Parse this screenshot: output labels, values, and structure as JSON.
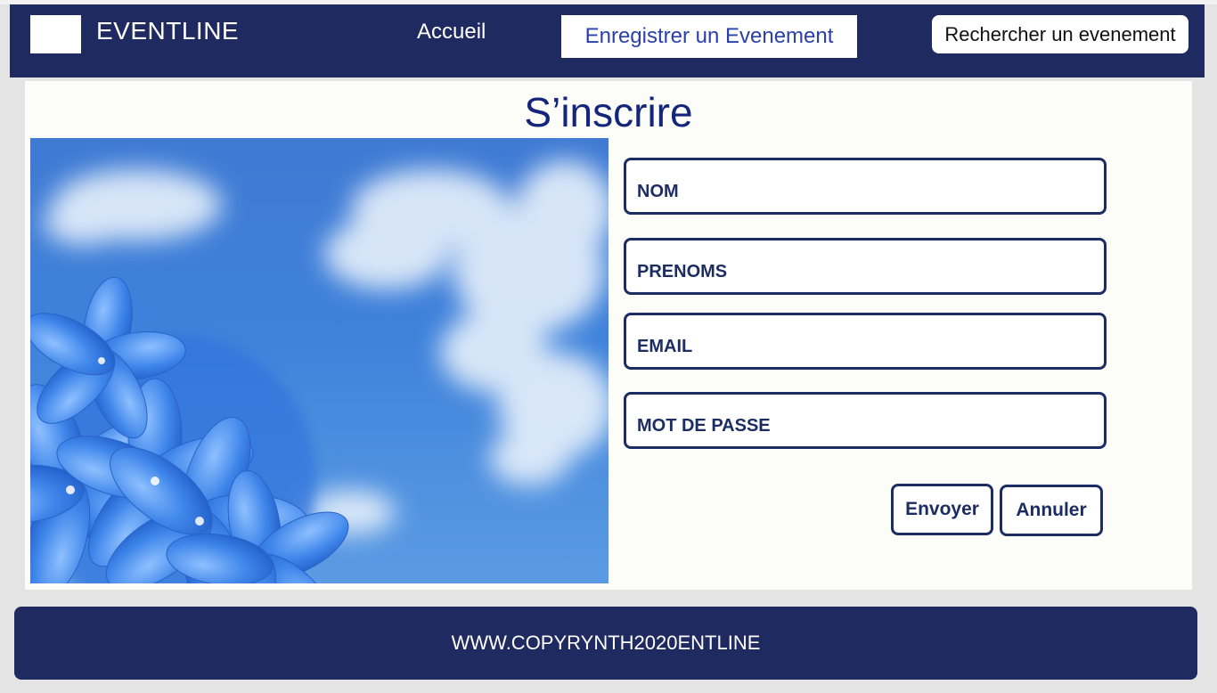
{
  "header": {
    "brand": "EVENTLINE",
    "nav": {
      "home": "Accueil",
      "register_event": "Enregistrer un Evenement",
      "search_event": "Rechercher un evenement"
    }
  },
  "main": {
    "title": "S’inscrire",
    "form": {
      "fields": [
        {
          "placeholder": "NOM",
          "value": ""
        },
        {
          "placeholder": "PRENOMS",
          "value": ""
        },
        {
          "placeholder": "EMAIL",
          "value": ""
        },
        {
          "placeholder": "MOT DE PASSE",
          "value": ""
        }
      ],
      "submit_label": "Envoyer",
      "cancel_label": "Annuler"
    }
  },
  "footer": {
    "text": "WWW.COPYRYNTH2020ENTLINE"
  },
  "colors": {
    "navy": "#1f2a60",
    "title_blue": "#14257a",
    "link_blue": "#2b40a8",
    "field_border": "#1c2d63"
  },
  "icons": {
    "hero_image": "blue-flowers-sky-image"
  }
}
